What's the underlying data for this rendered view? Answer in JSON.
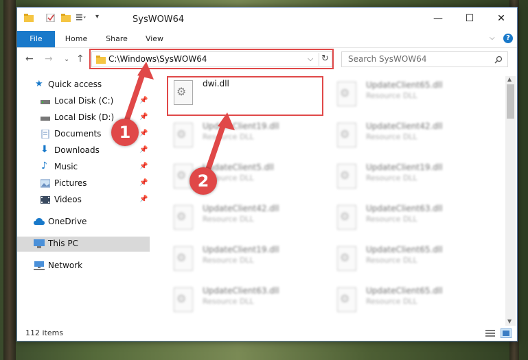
{
  "window": {
    "title": "SysWOW64"
  },
  "ribbon": {
    "tabs": [
      "File",
      "Home",
      "Share",
      "View"
    ]
  },
  "address": {
    "path": "C:\\Windows\\SysWOW64"
  },
  "search": {
    "placeholder": "Search SysWOW64"
  },
  "sidebar": {
    "items": [
      {
        "label": "Quick access"
      },
      {
        "label": "Local Disk (C:)"
      },
      {
        "label": "Local Disk (D:)"
      },
      {
        "label": "Documents"
      },
      {
        "label": "Downloads"
      },
      {
        "label": "Music"
      },
      {
        "label": "Pictures"
      },
      {
        "label": "Videos"
      },
      {
        "label": "OneDrive"
      },
      {
        "label": "This PC"
      },
      {
        "label": "Network"
      }
    ]
  },
  "files": [
    {
      "name": "dwi.dll",
      "type": ""
    },
    {
      "name": "UpdateClient65.dll",
      "type": "Resource DLL"
    },
    {
      "name": "UpdateClient19.dll",
      "type": "Resource DLL"
    },
    {
      "name": "UpdateClient42.dll",
      "type": "Resource DLL"
    },
    {
      "name": "UpdateClient5.dll",
      "type": "Resource DLL"
    },
    {
      "name": "UpdateClient19.dll",
      "type": "Resource DLL"
    },
    {
      "name": "UpdateClient42.dll",
      "type": "Resource DLL"
    },
    {
      "name": "UpdateClient63.dll",
      "type": "Resource DLL"
    },
    {
      "name": "UpdateClient19.dll",
      "type": "Resource DLL"
    },
    {
      "name": "UpdateClient65.dll",
      "type": "Resource DLL"
    },
    {
      "name": "UpdateClient63.dll",
      "type": "Resource DLL"
    },
    {
      "name": "UpdateClient65.dll",
      "type": "Resource DLL"
    }
  ],
  "status": {
    "items_count": "112 items"
  },
  "annotations": {
    "badge1": "1",
    "badge2": "2"
  },
  "colors": {
    "accent": "#1979ca",
    "annotation": "#e04848"
  }
}
